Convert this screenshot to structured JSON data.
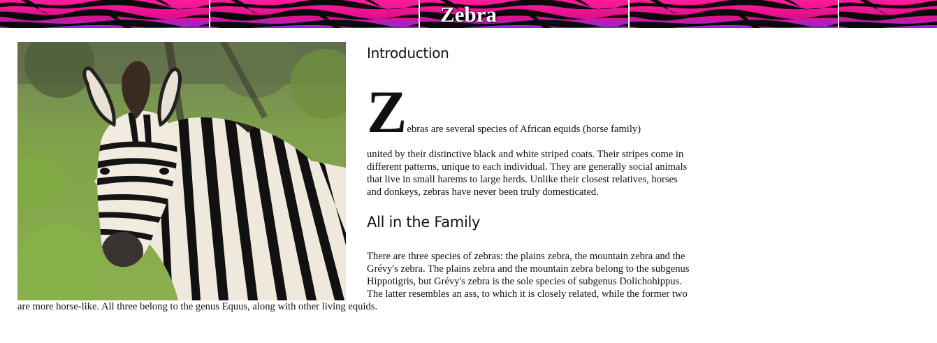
{
  "header": {
    "title": "Zebra",
    "colors": {
      "pink": "#ff1493",
      "magenta": "#cc0077",
      "purple": "#8a2be2",
      "stripe": "#0a0a0a",
      "divider": "#ffffff"
    }
  },
  "article": {
    "image_icon": "zebra-photo",
    "intro": {
      "heading": "Introduction",
      "dropcap": "Z",
      "first_line": "ebras are several species of African equids (horse family)",
      "body": "united by their distinctive black and white striped coats. Their stripes come in different patterns, unique to each individual. They are generally social animals that live in small harems to large herds. Unlike their closest relatives, horses and donkeys, zebras have never been truly domesticated."
    },
    "family": {
      "heading": "All in the Family",
      "body": "There are three species of zebras: the plains zebra, the mountain zebra and the Grévy's zebra. The plains zebra and the mountain zebra belong to the subgenus Hippotigris, but Grévy's zebra is the sole species of subgenus Dolichohippus. The latter resembles an ass, to which it is closely related, while the former two are more horse-like. All three belong to the genus Equus, along with other living equids."
    }
  }
}
